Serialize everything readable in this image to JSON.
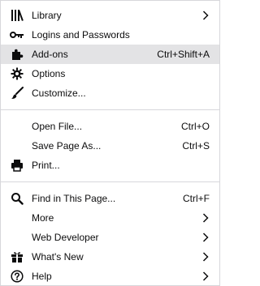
{
  "menu": {
    "section1": [
      {
        "label": "Library",
        "icon": "library-icon",
        "submenu": true
      },
      {
        "label": "Logins and Passwords",
        "icon": "key-icon"
      },
      {
        "label": "Add-ons",
        "icon": "puzzle-icon",
        "shortcut": "Ctrl+Shift+A",
        "highlighted": true
      },
      {
        "label": "Options",
        "icon": "gear-icon"
      },
      {
        "label": "Customize...",
        "icon": "paintbrush-icon"
      }
    ],
    "section2": [
      {
        "label": "Open File...",
        "shortcut": "Ctrl+O"
      },
      {
        "label": "Save Page As...",
        "shortcut": "Ctrl+S"
      },
      {
        "label": "Print...",
        "icon": "printer-icon"
      }
    ],
    "section3": [
      {
        "label": "Find in This Page...",
        "icon": "search-icon",
        "shortcut": "Ctrl+F"
      },
      {
        "label": "More",
        "submenu": true
      },
      {
        "label": "Web Developer",
        "submenu": true
      },
      {
        "label": "What's New",
        "icon": "gift-icon",
        "submenu": true
      },
      {
        "label": "Help",
        "icon": "help-icon",
        "submenu": true
      }
    ]
  },
  "colors": {
    "highlight": "#e3e3e5",
    "separator": "#d7d7db",
    "text": "#0c0c0d"
  }
}
